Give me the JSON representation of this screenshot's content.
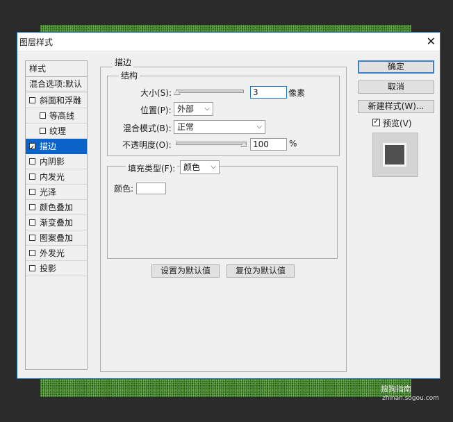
{
  "dialog": {
    "title": "图层样式",
    "close": "✕"
  },
  "styles_panel": {
    "header": "样式",
    "blend_options": "混合选项:默认",
    "items": [
      {
        "label": "斜面和浮雕",
        "checked": false,
        "indent": false,
        "selected": false
      },
      {
        "label": "等高线",
        "checked": false,
        "indent": true,
        "selected": false
      },
      {
        "label": "纹理",
        "checked": false,
        "indent": true,
        "selected": false
      },
      {
        "label": "描边",
        "checked": true,
        "indent": false,
        "selected": true
      },
      {
        "label": "内阴影",
        "checked": false,
        "indent": false,
        "selected": false
      },
      {
        "label": "内发光",
        "checked": false,
        "indent": false,
        "selected": false
      },
      {
        "label": "光泽",
        "checked": false,
        "indent": false,
        "selected": false
      },
      {
        "label": "颜色叠加",
        "checked": false,
        "indent": false,
        "selected": false
      },
      {
        "label": "渐变叠加",
        "checked": false,
        "indent": false,
        "selected": false
      },
      {
        "label": "图案叠加",
        "checked": false,
        "indent": false,
        "selected": false
      },
      {
        "label": "外发光",
        "checked": false,
        "indent": false,
        "selected": false
      },
      {
        "label": "投影",
        "checked": false,
        "indent": false,
        "selected": false
      }
    ]
  },
  "stroke": {
    "section_title": "描边",
    "structure_title": "结构",
    "size_label": "大小(S):",
    "size_value": "3",
    "size_unit": "像素",
    "position_label": "位置(P):",
    "position_value": "外部",
    "blend_label": "混合模式(B):",
    "blend_value": "正常",
    "opacity_label": "不透明度(O):",
    "opacity_value": "100",
    "opacity_unit": "%",
    "fill_type_label": "填充类型(F):",
    "fill_type_value": "颜色",
    "color_label": "颜色:",
    "color_value": "#ffffff",
    "set_default": "设置为默认值",
    "reset_default": "复位为默认值"
  },
  "buttons": {
    "ok": "确定",
    "cancel": "取消",
    "new_style": "新建样式(W)...",
    "preview_label": "预览(V)",
    "preview_checked": true
  },
  "watermark": {
    "text": "搜狗指南",
    "url": "zhinan.sogou.com"
  },
  "colors": {
    "accent": "#0a63c9",
    "swatch_preview": "#505050"
  }
}
